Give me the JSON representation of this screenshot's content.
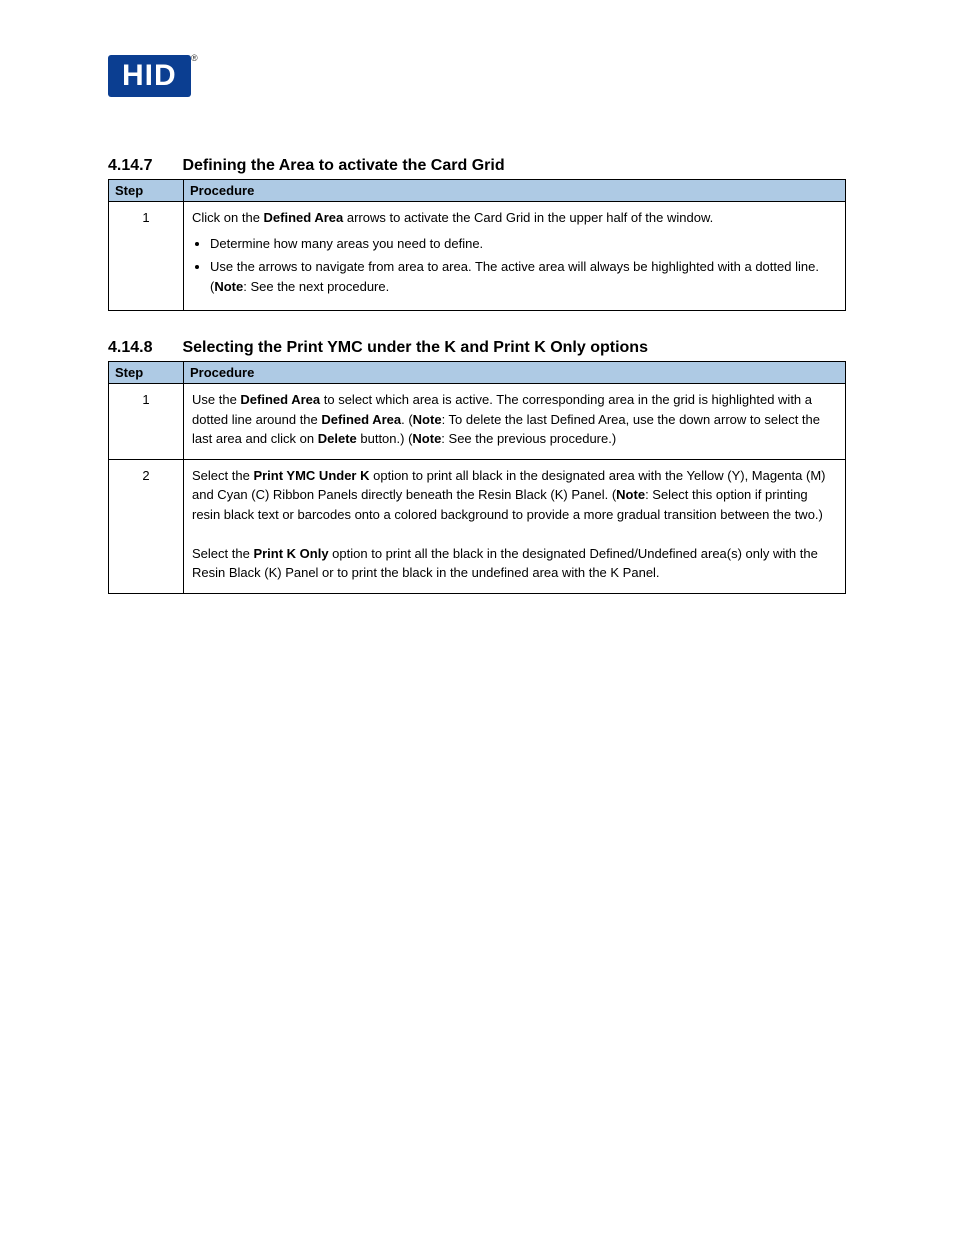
{
  "logo": {
    "text": "HID",
    "reg": "®"
  },
  "section1": {
    "number": "4.14.7",
    "title": "Defining the Area to activate the Card Grid",
    "headers": {
      "step": "Step",
      "procedure": "Procedure"
    },
    "rows": [
      {
        "step": "1",
        "para1_pre": "Click on the ",
        "para1_bold": "Defined Area",
        "para1_post": " arrows to activate the Card Grid in the upper half of the window.",
        "bullets": [
          "Determine how many areas you need to define.",
          "Use the arrows to navigate from area to area. The active area will always be highlighted with a dotted line. (",
          ") "
        ],
        "note_word": "Note",
        "note_after": ": See the next procedure."
      }
    ]
  },
  "section2": {
    "number": "4.14.8",
    "title": "Selecting the Print YMC under the K and Print K Only options",
    "headers": {
      "step": "Step",
      "procedure": "Procedure"
    },
    "rows": [
      {
        "step": "1",
        "p1_a": "Use the ",
        "p1_b": "Defined Area",
        "p1_c": " to select which area is active. The corresponding area in the grid is highlighted with a dotted line around the ",
        "p1_d": "Defined Area",
        "p1_e": ". (",
        "p1_note": "Note",
        "p1_f": ": To delete the last Defined Area, use the down arrow to select the last area and click on ",
        "p1_delete": "Delete",
        "p1_g": " button.) (",
        "p1_note2": "Note",
        "p1_h": ": See the previous procedure.)"
      },
      {
        "step": "2",
        "p2_a": "Select the ",
        "p2_b": "Print YMC Under K",
        "p2_c": " option to print all black in the designated area with the Yellow (Y), Magenta (M) and Cyan (C) Ribbon Panels directly beneath the Resin Black (K) Panel. (",
        "p2_note": "Note",
        "p2_d": ": Select this option if printing resin black text or barcodes onto a colored background to provide a more gradual transition between the two.)",
        "br": "",
        "p3_a": "Select the ",
        "p3_b": "Print K Only",
        "p3_c": " option to print all the black in the designated Defined/Undefined area(s) only with the Resin Black (K) Panel or to print the black in the undefined area with the K Panel."
      }
    ]
  }
}
